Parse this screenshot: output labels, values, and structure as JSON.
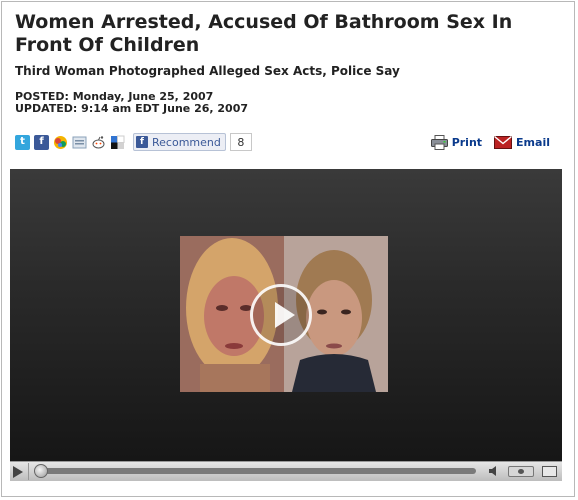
{
  "article": {
    "headline": "Women Arrested, Accused Of Bathroom Sex In Front Of Children",
    "subheadline": "Third Woman Photographed Alleged Sex Acts, Police Say",
    "posted": "POSTED: Monday, June 25, 2007",
    "updated": "UPDATED: 9:14 am EDT June 26, 2007"
  },
  "share": {
    "icons": [
      "twitter-icon",
      "facebook-icon",
      "buzz-icon",
      "digg-icon",
      "reddit-icon",
      "delicious-icon"
    ],
    "recommend_label": "Recommend",
    "recommend_count": "8"
  },
  "tools": {
    "print_label": "Print",
    "email_label": "Email"
  },
  "video": {
    "poster_icon": "play-icon",
    "progress": 0.0
  },
  "colors": {
    "text": "#222222",
    "link": "#0a3a8c",
    "facebook": "#3b5998",
    "player_bg": "#2a2a2a"
  }
}
